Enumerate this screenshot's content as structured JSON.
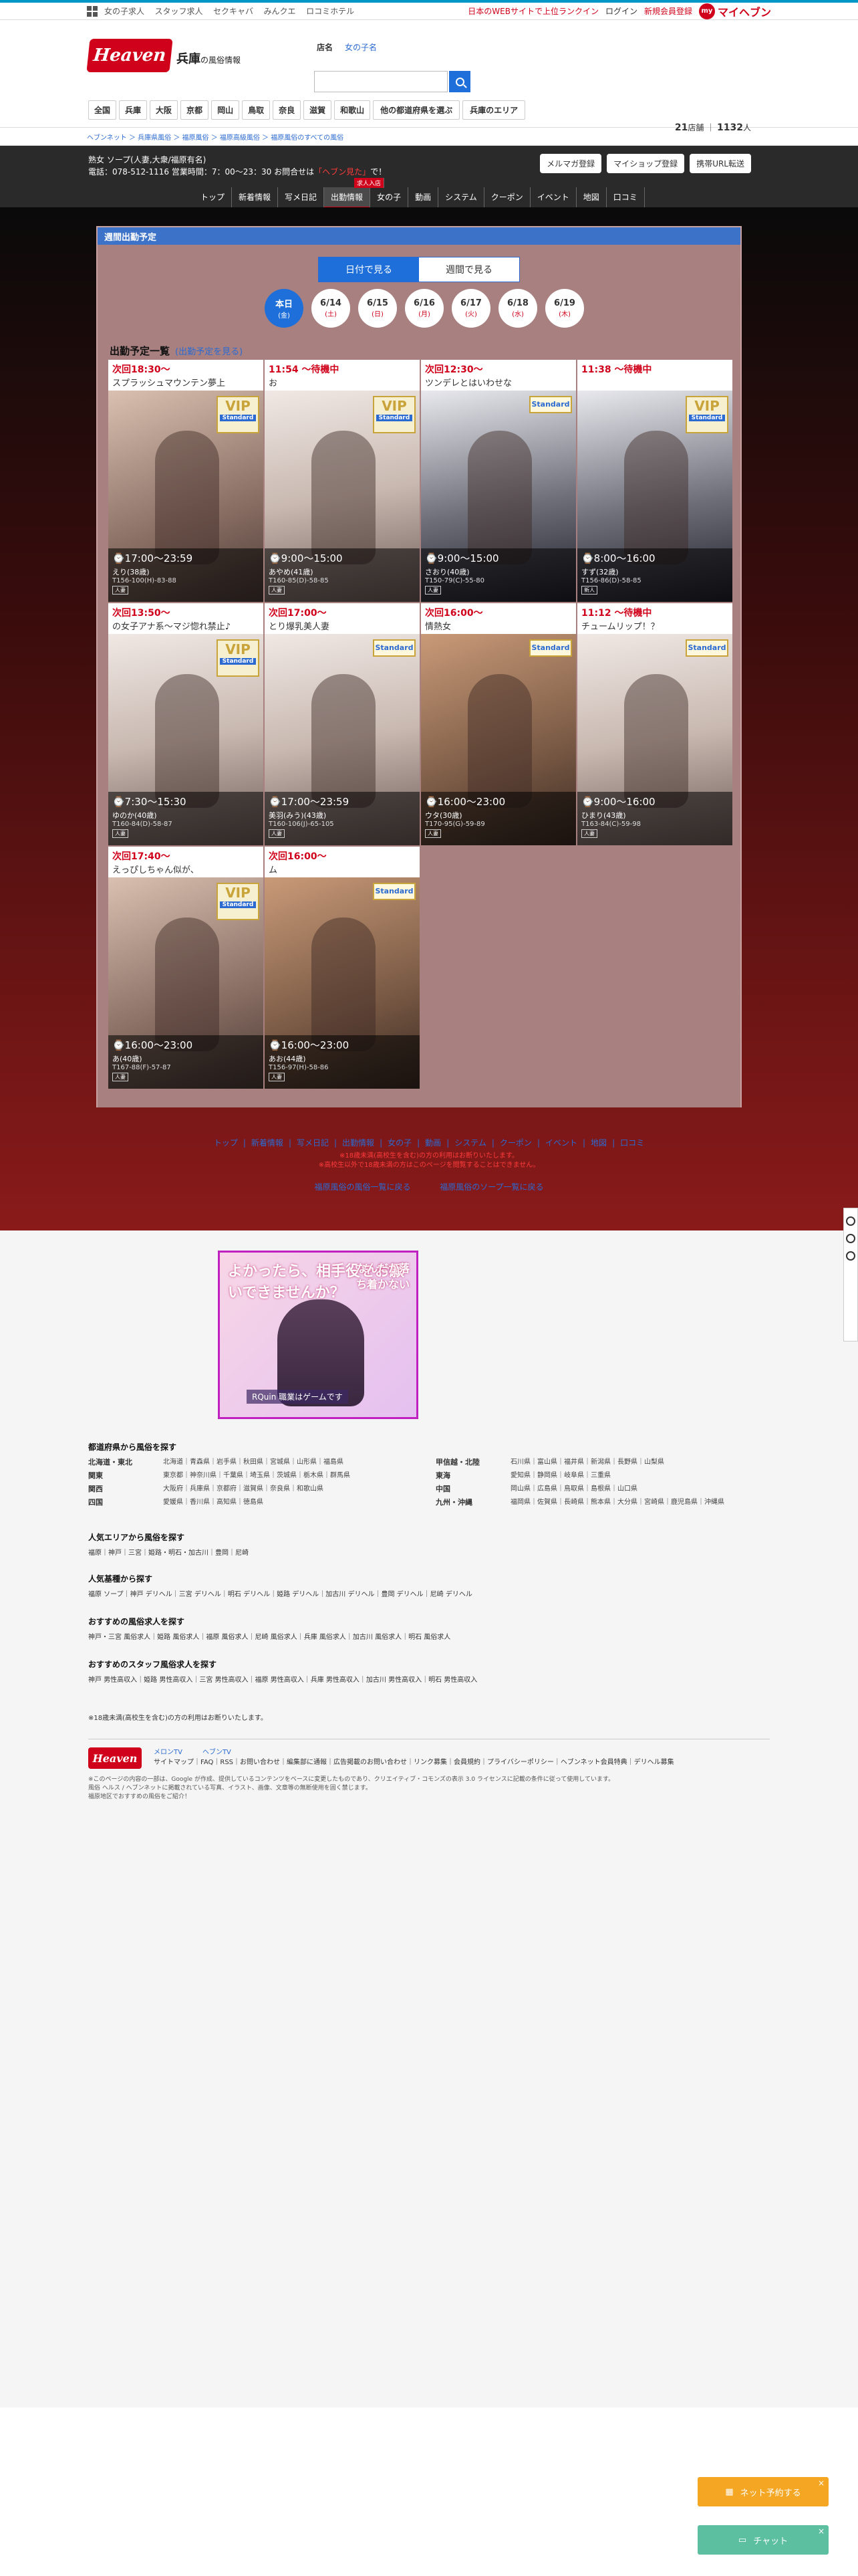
{
  "topbar": {
    "links": [
      "女の子求人",
      "スタッフ求人",
      "セクキャバ",
      "みんクエ",
      "ロコミホテル"
    ],
    "right": [
      "日本のWEBサイトで上位ランクイン",
      "ログイン",
      "新規会員登録"
    ],
    "myheaven": "マイヘブン",
    "my_badge": "my"
  },
  "header": {
    "logo": "Heaven",
    "pref": "兵庫",
    "pref_sub": "の風俗情報",
    "search_label": "店名",
    "search_placeholder": "女の子名",
    "area_nav": [
      "全国",
      "兵庫",
      "大阪",
      "京都",
      "岡山",
      "鳥取",
      "奈良",
      "滋賀",
      "和歌山",
      "他の都道府県を選ぶ",
      "兵庫のエリア"
    ],
    "shop_count": "21",
    "shop_unit": "店舗",
    "girl_count": "1132",
    "girl_unit": "人"
  },
  "breadcrumb": "ヘブンネット ＞ 兵庫県風俗 ＞ 福原風俗 ＞ 福原高級風俗 ＞ 福原風俗のすべての風俗",
  "shop": {
    "line1": "熟女 ソープ(人妻,大衆/福原有名)",
    "line2_pre": "電話：078-512-1116 営業時間：7：00〜23：30 お問合せは",
    "line2_hl": "「ヘブン見た」",
    "line2_post": "で！",
    "buttons": [
      "メルマガ登録",
      "マイショップ登録",
      "携帯URL転送"
    ],
    "nav": [
      "トップ",
      "新着情報",
      "写メ日記",
      "出勤情報",
      "女の子",
      "動画",
      "システム",
      "クーポン",
      "イベント",
      "地図",
      "口コミ"
    ],
    "nav_new_tag": "求人入店"
  },
  "schedule": {
    "panel_title": "週間出勤予定",
    "toggle": [
      "日付で見る",
      "週間で見る"
    ],
    "days": [
      {
        "d": "本日",
        "w": "(金)"
      },
      {
        "d": "6/14",
        "w": "(土)"
      },
      {
        "d": "6/15",
        "w": "(日)"
      },
      {
        "d": "6/16",
        "w": "(月)"
      },
      {
        "d": "6/17",
        "w": "(火)"
      },
      {
        "d": "6/18",
        "w": "(水)"
      },
      {
        "d": "6/19",
        "w": "(木)"
      }
    ],
    "list_title": "出勤予定一覧",
    "list_link": "(出勤予定を見る)",
    "cards": [
      {
        "head": "次回18:30〜",
        "catch": "スプラッシュマウンテン夢上",
        "time": "⌚17:00〜23:59",
        "name": "えり(38歳)",
        "size": "T156-100(H)-83-88",
        "tag": "人妻"
      },
      {
        "head": "11:54 〜待機中",
        "catch": "お",
        "time": "⌚9:00〜15:00",
        "name": "あやめ(41歳)",
        "size": "T160-85(D)-58-85",
        "tag": "人妻"
      },
      {
        "head": "次回12:30〜",
        "catch": "ツンデレとはいわせな",
        "time": "⌚9:00〜15:00",
        "name": "さおり(40歳)",
        "size": "T150-79(C)-55-80",
        "tag": "人妻"
      },
      {
        "head": "11:38 〜待機中",
        "catch": "",
        "time": "⌚8:00〜16:00",
        "name": "すず(32歳)",
        "size": "T156-86(D)-58-85",
        "tag": "新人"
      },
      {
        "head": "次回13:50〜",
        "catch": "の女子アナ系〜マジ惚れ禁止♪",
        "time": "⌚7:30〜15:30",
        "name": "ゆのか(40歳)",
        "size": "T160-84(D)-58-87",
        "tag": "人妻"
      },
      {
        "head": "次回17:00〜",
        "catch": "とり爆乳美人妻",
        "time": "⌚17:00〜23:59",
        "name": "美羽(みう)(43歳)",
        "size": "T160-106(J)-65-105",
        "tag": "人妻"
      },
      {
        "head": "次回16:00〜",
        "catch": "情熱女",
        "time": "⌚16:00〜23:00",
        "name": "ウタ(30歳)",
        "size": "T170-95(G)-59-89",
        "tag": "人妻"
      },
      {
        "head": "11:12 〜待機中",
        "catch": "チュームリップ！？",
        "time": "⌚9:00〜16:00",
        "name": "ひまり(43歳)",
        "size": "T163-84(C)-59-98",
        "tag": "人妻"
      },
      {
        "head": "次回17:40〜",
        "catch": "えっぴしちゃん似が、",
        "time": "⌚16:00〜23:00",
        "name": "あ(40歳)",
        "size": "T167-88(F)-57-87",
        "tag": "人妻"
      },
      {
        "head": "次回16:00〜",
        "catch": "ム",
        "time": "⌚16:00〜23:00",
        "name": "あお(44歳)",
        "size": "T156-97(H)-58-86",
        "tag": "人妻"
      }
    ],
    "badges": {
      "vip": "VIP",
      "standard": "Standard"
    }
  },
  "footer_dark": {
    "nav": [
      "トップ",
      "新着情報",
      "写メ日記",
      "出勤情報",
      "女の子",
      "動画",
      "システム",
      "クーポン",
      "イベント",
      "地図",
      "口コミ"
    ],
    "note1": "※18歳未満(高校生を含む)の方の利用はお断りいたします。",
    "note2": "※高校生以外で18歳未満の方はこのページを閲覧することはできません。",
    "links": [
      "福原風俗の風俗一覧に戻る",
      "福原風俗のソープ一覧に戻る"
    ]
  },
  "banner": {
    "t1": "よかったら、相手役をお願いできませんか？",
    "t2": "なんだか落ち着かない",
    "foot": "RQuin 職業はゲームです"
  },
  "lower": {
    "pref_title": "都道府県から風俗を探す",
    "regions": [
      {
        "r": "北海道・東北",
        "p": "北海道｜青森県｜岩手県｜秋田県｜宮城県｜山形県｜福島県"
      },
      {
        "r": "甲信越・北陸",
        "p": "石川県｜富山県｜福井県｜新潟県｜長野県｜山梨県"
      },
      {
        "r": "関東",
        "p": "東京都｜神奈川県｜千葉県｜埼玉県｜茨城県｜栃木県｜群馬県"
      },
      {
        "r": "東海",
        "p": "愛知県｜静岡県｜岐阜県｜三重県"
      },
      {
        "r": "関西",
        "p": "大阪府｜兵庫県｜京都府｜滋賀県｜奈良県｜和歌山県"
      },
      {
        "r": "中国",
        "p": "岡山県｜広島県｜鳥取県｜島根県｜山口県"
      },
      {
        "r": "四国",
        "p": "愛媛県｜香川県｜高知県｜徳島県"
      },
      {
        "r": "九州・沖縄",
        "p": "福岡県｜佐賀県｜長崎県｜熊本県｜大分県｜宮崎県｜鹿児島県｜沖縄県"
      }
    ],
    "pop_area_title": "人気エリアから風俗を探す",
    "pop_area": "福原｜神戸｜三宮｜姫路・明石・加古川｜豊岡｜尼崎",
    "pop_genre_title": "人気基種から探す",
    "pop_genre": "福原 ソープ｜神戸 デリヘル｜三宮 デリヘル｜明石 デリヘル｜姫路 デリヘル｜加古川 デリヘル｜豊岡 デリヘル｜尼崎 デリヘル",
    "rec_girl_title": "おすすめの風俗求人を探す",
    "rec_girl": "神戸・三宮 風俗求人｜姫路 風俗求人｜福原 風俗求人｜尼崎 風俗求人｜兵庫 風俗求人｜加古川 風俗求人｜明石 風俗求人",
    "rec_staff_title": "おすすめのスタッフ風俗求人を探す",
    "rec_staff": "神戸 男性高収入｜姫路 男性高収入｜三宮 男性高収入｜福原 男性高収入｜兵庫 男性高収入｜加古川 男性高収入｜明石 男性高収入",
    "age_note": "※18歳未満(高校生を含む)の方の利用はお断りいたします。",
    "foot_logo": "Heaven",
    "apps": [
      "メロンTV",
      "ヘブンTV"
    ],
    "foot_links": "サイトマップ｜FAQ｜RSS｜お問い合わせ｜編集部に通報｜広告掲載のお問い合わせ｜リンク募集｜会員規約｜プライバシーポリシー｜ヘブンネット会員特典｜デリヘル募集",
    "copy1": "※このページの内容の一部は、Google が作成、提供しているコンテンツをベースに変更したものであり、クリエイティブ・コモンズの表示 3.0 ライセンスに記載の条件に従って使用しています。",
    "copy2": "風俗 ヘルス / ヘブンネットに掲載されている写真、イラスト、画像、文章等の無断使用を固く禁じます。",
    "copy3": "福原地区でおすすめの風俗をご紹介！"
  },
  "float": {
    "reserve": "ネット予約する",
    "chat": "チャット",
    "close": "×"
  }
}
